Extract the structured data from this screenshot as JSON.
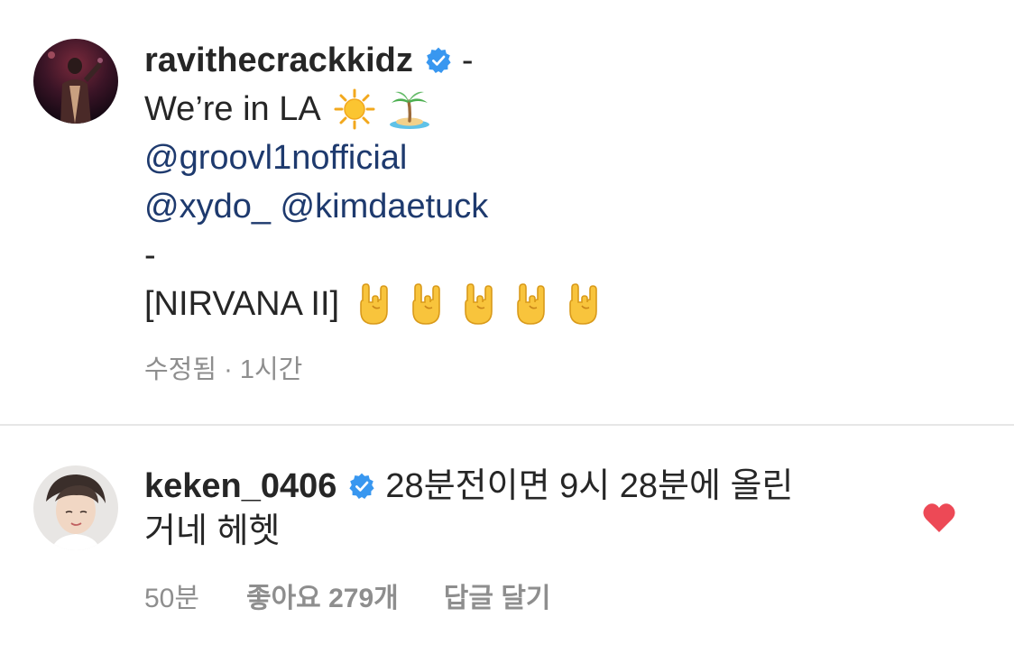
{
  "post": {
    "author": "ravithecrackkidz",
    "verified_icon": "verified-badge-icon",
    "dash_1": "-",
    "line_la": "We’re in LA",
    "emoji_sun": "sun-emoji-icon",
    "emoji_island": "palm-island-emoji-icon",
    "mention_1": "@groovl1nofficial",
    "mention_2": "@xydo_",
    "mention_3": "@kimdaetuck",
    "dash_2": "-",
    "tag": "[NIRVANA II]",
    "emoji_horns_count": 5,
    "emoji_horns": "sign-of-horns-emoji-icon",
    "edited_label": "수정됨",
    "separator": " · ",
    "time": "1시간"
  },
  "comment": {
    "author": "keken_0406",
    "verified_icon": "verified-badge-icon",
    "text_line1": "28분전이면 9시 28분에 올린",
    "text_line2": "거네 헤헷",
    "time": "50분",
    "likes": "좋아요 279개",
    "reply_label": "답글 달기",
    "liked": true,
    "heart_color": "#ed4956"
  },
  "colors": {
    "text": "#262626",
    "mention": "#1e3a6e",
    "muted": "#8e8e8e",
    "verified": "#3897f0",
    "divider": "#e6e6e6"
  }
}
